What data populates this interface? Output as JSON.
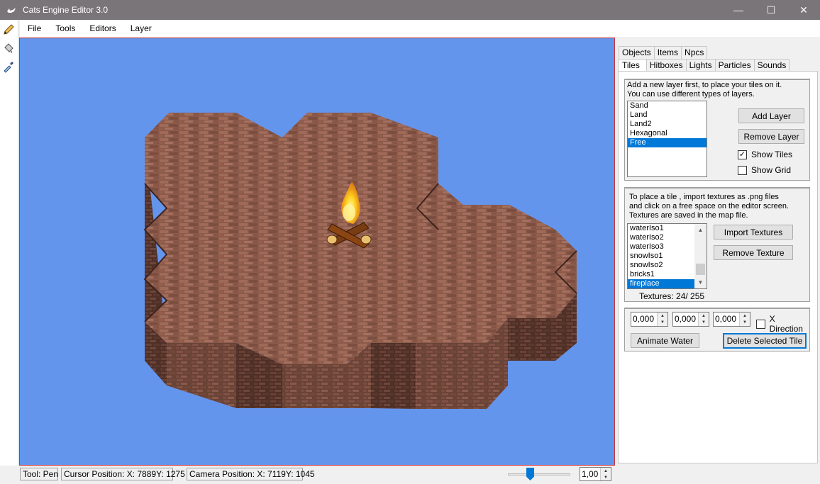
{
  "window": {
    "title": "Cats Engine Editor 3.0",
    "minimize": "—",
    "maximize": "☐",
    "close": "✕"
  },
  "menu": [
    "File",
    "Tools",
    "Editors",
    "Layer"
  ],
  "tools": [
    "pen",
    "bucket",
    "eyedropper"
  ],
  "tabs": {
    "row1": [
      "Objects",
      "Items",
      "Npcs"
    ],
    "row2": [
      "Tiles",
      "Hitboxes",
      "Lights",
      "Particles",
      "Sounds"
    ],
    "active": "Tiles"
  },
  "layers": {
    "hint1": "Add a new layer first, to place your tiles on it.",
    "hint2": "You can use different types of layers.",
    "items": [
      "Sand",
      "Land",
      "Land2",
      "Hexagonal",
      "Free"
    ],
    "selected": "Free",
    "add_label": "Add Layer",
    "remove_label": "Remove Layer",
    "show_tiles_label": "Show Tiles",
    "show_tiles_checked": true,
    "show_grid_label": "Show Grid",
    "show_grid_checked": false
  },
  "textures": {
    "hint1": "To place a tile , import textures as .png files",
    "hint2": "and click on a free space on the editor screen.",
    "hint3": "Textures are saved in the map file.",
    "items": [
      "waterIso1",
      "waterIso2",
      "waterIso3",
      "snowIso1",
      "snowIso2",
      "bricks1",
      "fireplace"
    ],
    "selected": "fireplace",
    "import_label": "Import Textures",
    "remove_label": "Remove Texture",
    "count_text": "Textures: 24/ 255"
  },
  "tile": {
    "spin1": "0,000",
    "spin2": "0,000",
    "spin3": "0,000",
    "x_direction_label": "X Direction",
    "x_direction_checked": false,
    "animate_label": "Animate Water",
    "delete_label": "Delete Selected Tile"
  },
  "status": {
    "tool": "Tool: Pen",
    "cursor": "Cursor Position: X: 7889Y: 1275",
    "camera": "Camera Position: X: 7119Y: 1045",
    "zoom": "1,00"
  },
  "colors": {
    "sky": "#6495ed",
    "brick": "#8b5a4a",
    "selection": "#0078d7"
  }
}
